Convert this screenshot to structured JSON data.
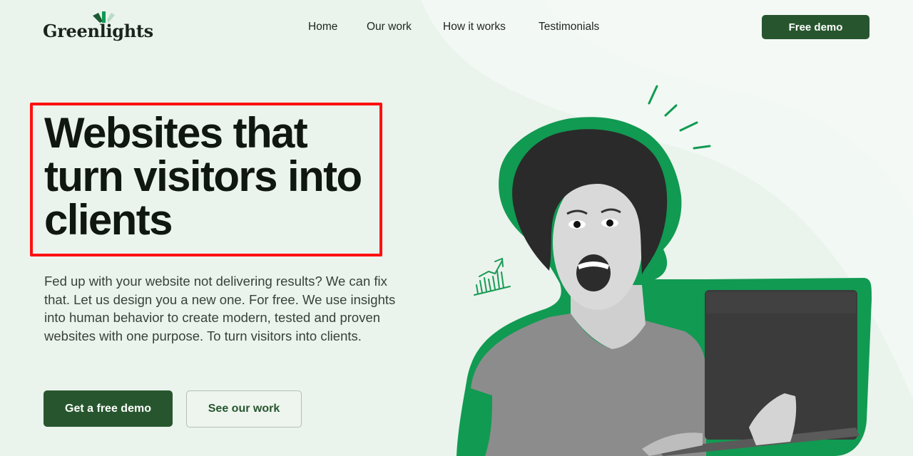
{
  "brand": {
    "name": "Greenlights",
    "primary_color": "#27562e",
    "accent_green": "#0e9a54",
    "highlight_color": "#ff1010"
  },
  "nav": {
    "items": [
      {
        "label": "Home"
      },
      {
        "label": "Our work"
      },
      {
        "label": "How it works"
      },
      {
        "label": "Testimonials"
      }
    ],
    "cta_label": "Free demo"
  },
  "hero": {
    "title": "Websites that turn visitors into clients",
    "description": "Fed up with your website not delivering results? We can fix that. Let us design you a new one. For free. We use insights into human behavior to create modern, tested and proven websites with one purpose. To turn visitors into clients.",
    "primary_button": "Get a free demo",
    "secondary_button": "See our work"
  },
  "illustration": {
    "subject": "excited woman holding laptop",
    "icons": [
      "growth-chart-icon",
      "excitement-lines-icon"
    ]
  }
}
